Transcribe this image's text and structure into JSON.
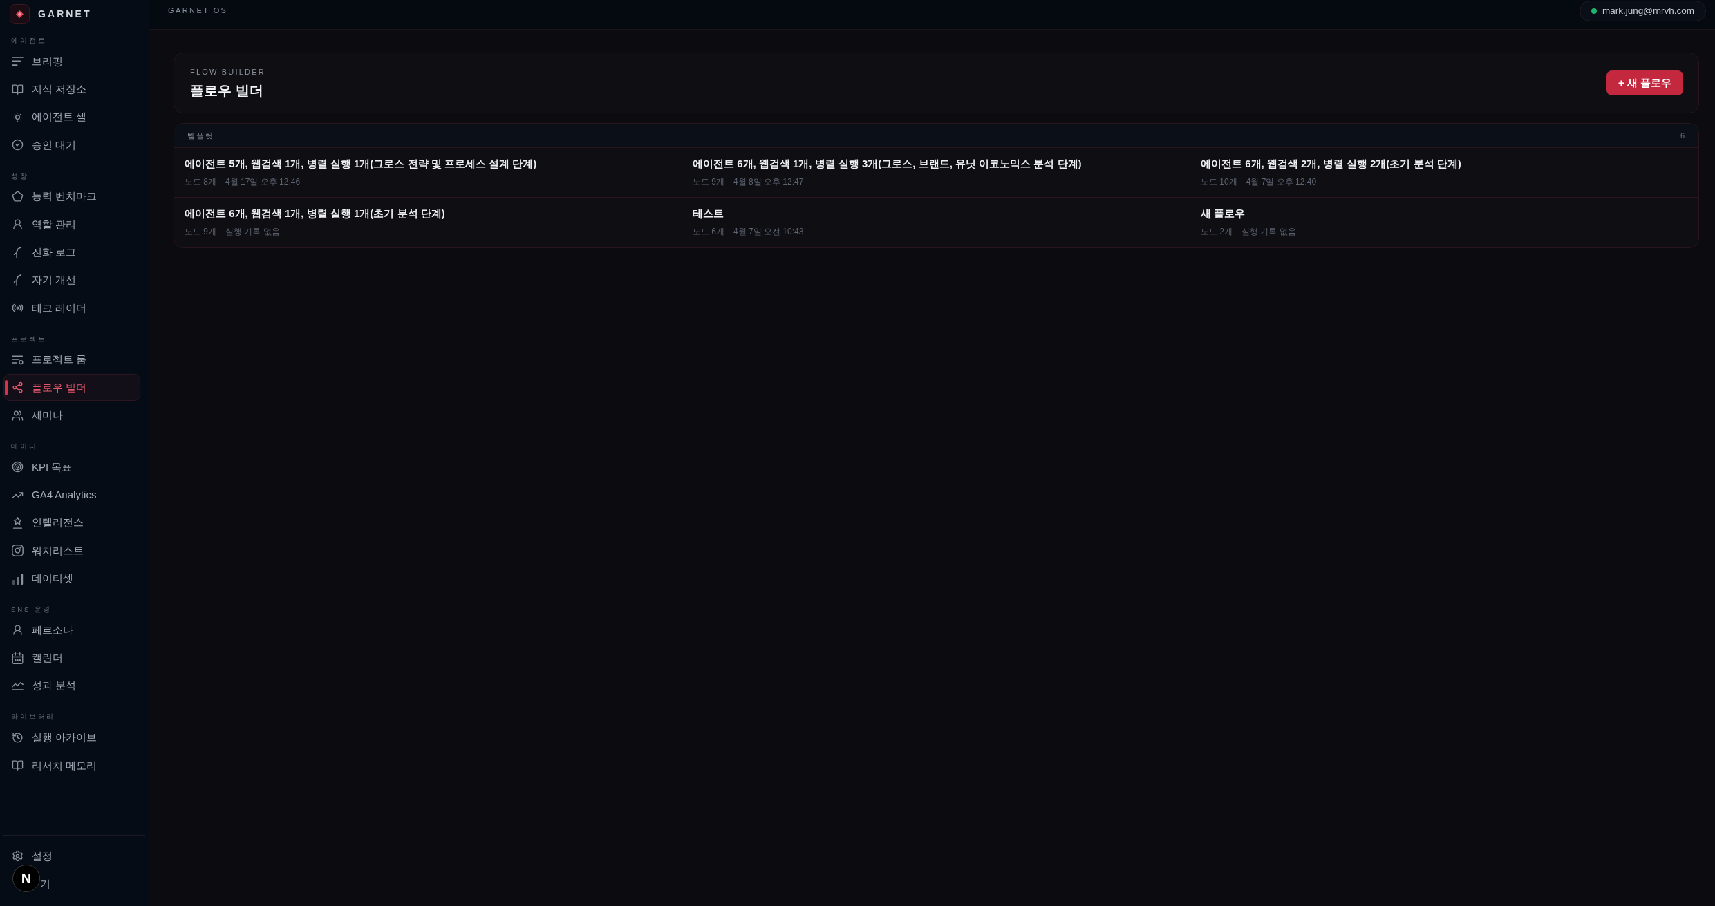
{
  "brand": {
    "name": "GARNET"
  },
  "sidebar": {
    "sections": [
      {
        "label": "에이전트",
        "items": [
          {
            "label": "브리핑",
            "selected": false
          },
          {
            "label": "지식 저장소",
            "selected": false
          },
          {
            "label": "에이전트 셀",
            "selected": false
          },
          {
            "label": "승인 대기",
            "selected": false
          }
        ]
      },
      {
        "label": "성장",
        "items": [
          {
            "label": "능력 벤치마크",
            "selected": false
          },
          {
            "label": "역할 관리",
            "selected": false
          },
          {
            "label": "진화 로그",
            "selected": false
          },
          {
            "label": "자기 개선",
            "selected": false
          },
          {
            "label": "테크 레이더",
            "selected": false
          }
        ]
      },
      {
        "label": "프로젝트",
        "items": [
          {
            "label": "프로젝트 룸",
            "selected": false
          },
          {
            "label": "플로우 빌더",
            "selected": true
          },
          {
            "label": "세미나",
            "selected": false
          }
        ]
      },
      {
        "label": "데이터",
        "items": [
          {
            "label": "KPI 목표",
            "selected": false
          },
          {
            "label": "GA4 Analytics",
            "selected": false
          },
          {
            "label": "인텔리전스",
            "selected": false
          },
          {
            "label": "워치리스트",
            "selected": false
          },
          {
            "label": "데이터셋",
            "selected": false
          }
        ]
      },
      {
        "label": "SNS 운영",
        "items": [
          {
            "label": "페르소나",
            "selected": false
          },
          {
            "label": "캘린더",
            "selected": false
          },
          {
            "label": "성과 분석",
            "selected": false
          }
        ]
      },
      {
        "label": "라이브러리",
        "items": [
          {
            "label": "실행 아카이브",
            "selected": false
          },
          {
            "label": "리서치 메모리",
            "selected": false
          }
        ]
      }
    ],
    "footer_items": [
      {
        "label": "설정",
        "selected": false
      },
      {
        "label": "기",
        "selected": false
      }
    ]
  },
  "header": {
    "title": "GARNET OS",
    "user": {
      "email": "mark.jung@rnrvh.com",
      "online": true
    }
  },
  "page_header": {
    "eyebrow": "FLOW BUILDER",
    "title": "플로우 빌더",
    "action": "+ 새 플로우"
  },
  "templates": {
    "title": "템플릿",
    "count": "6",
    "items": [
      {
        "title": "에이전트 5개, 웹검색 1개, 병렬 실행 1개(그로스 전략 및 프로세스 설계 단계)",
        "nodes": "노드 8개",
        "last_run": "4월 17일 오후 12:46"
      },
      {
        "title": "에이전트 6개, 웹검색 1개, 병렬 실행 3개(그로스, 브랜드, 유닛 이코노믹스 분석 단계)",
        "nodes": "노드 9개",
        "last_run": "4월 8일 오후 12:47"
      },
      {
        "title": "에이전트 6개, 웹검색 2개, 병렬 실행 2개(초기 분석 단계)",
        "nodes": "노드 10개",
        "last_run": "4월 7일 오후 12:40"
      },
      {
        "title": "에이전트 6개, 웹검색 1개, 병렬 실행 1개(초기 분석 단계)",
        "nodes": "노드 9개",
        "last_run": "실행 기록 없음"
      },
      {
        "title": "테스트",
        "nodes": "노드 6개",
        "last_run": "4월 7일 오전 10:43"
      },
      {
        "title": "새 플로우",
        "nodes": "노드 2개",
        "last_run": "실행 기록 없음"
      }
    ]
  },
  "dev_badge": {
    "label": "N"
  }
}
